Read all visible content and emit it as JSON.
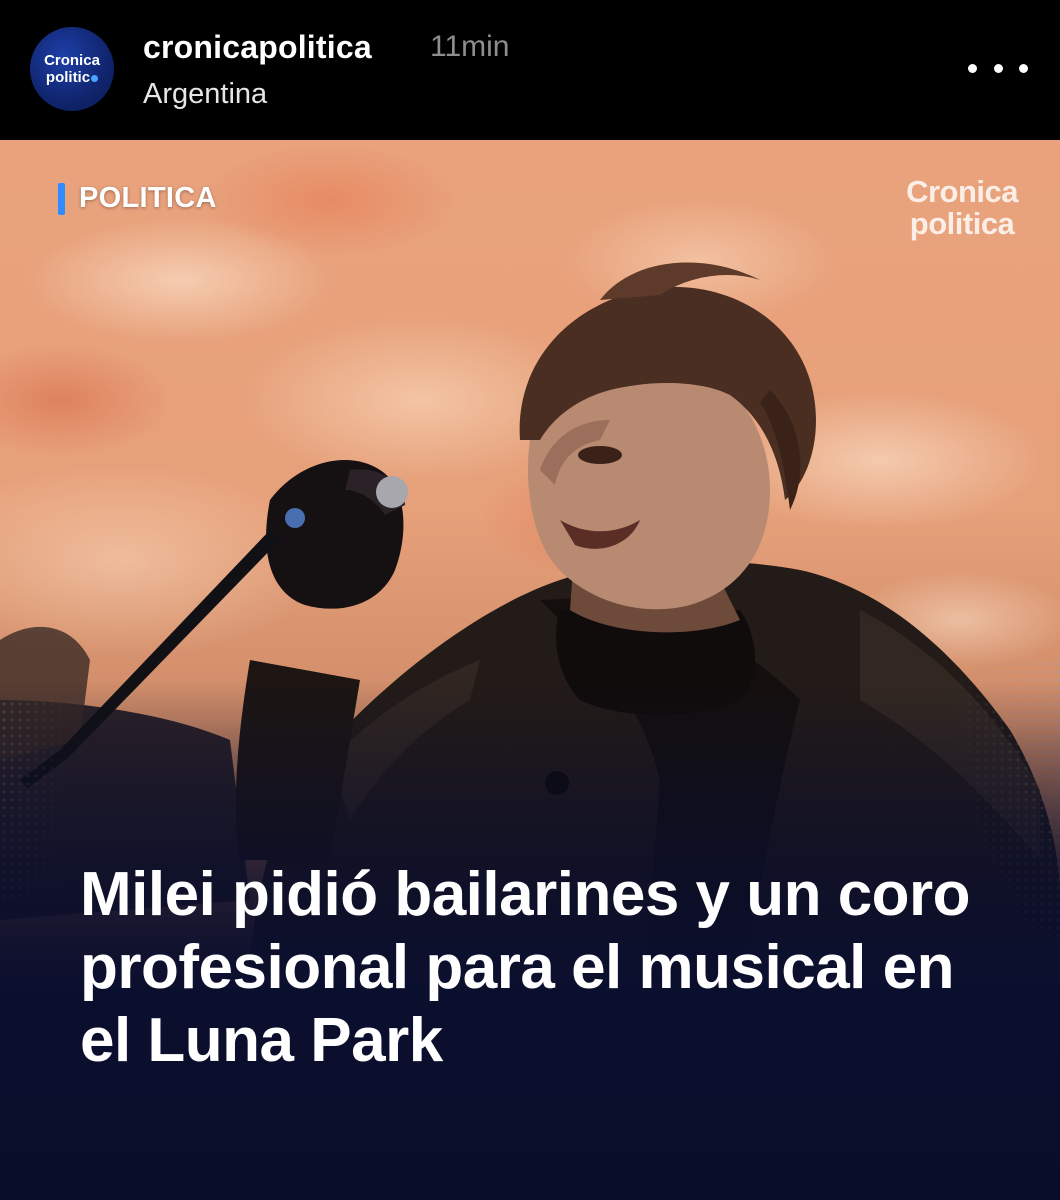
{
  "post": {
    "avatar_text_line1": "Cronica",
    "avatar_text_line2": "politic",
    "username": "cronicapolitica",
    "timestamp": "11min",
    "location": "Argentina"
  },
  "image": {
    "category": "POLITICA",
    "watermark_line1": "Cronica",
    "watermark_line2": "politica",
    "headline": "Milei pidió bailarines y un coro profesional para el musical en el Luna Park"
  },
  "colors": {
    "accent": "#2f8bff",
    "header_bg": "#000000",
    "timestamp": "#8e8e8e",
    "navy": "#0b0f2e"
  }
}
